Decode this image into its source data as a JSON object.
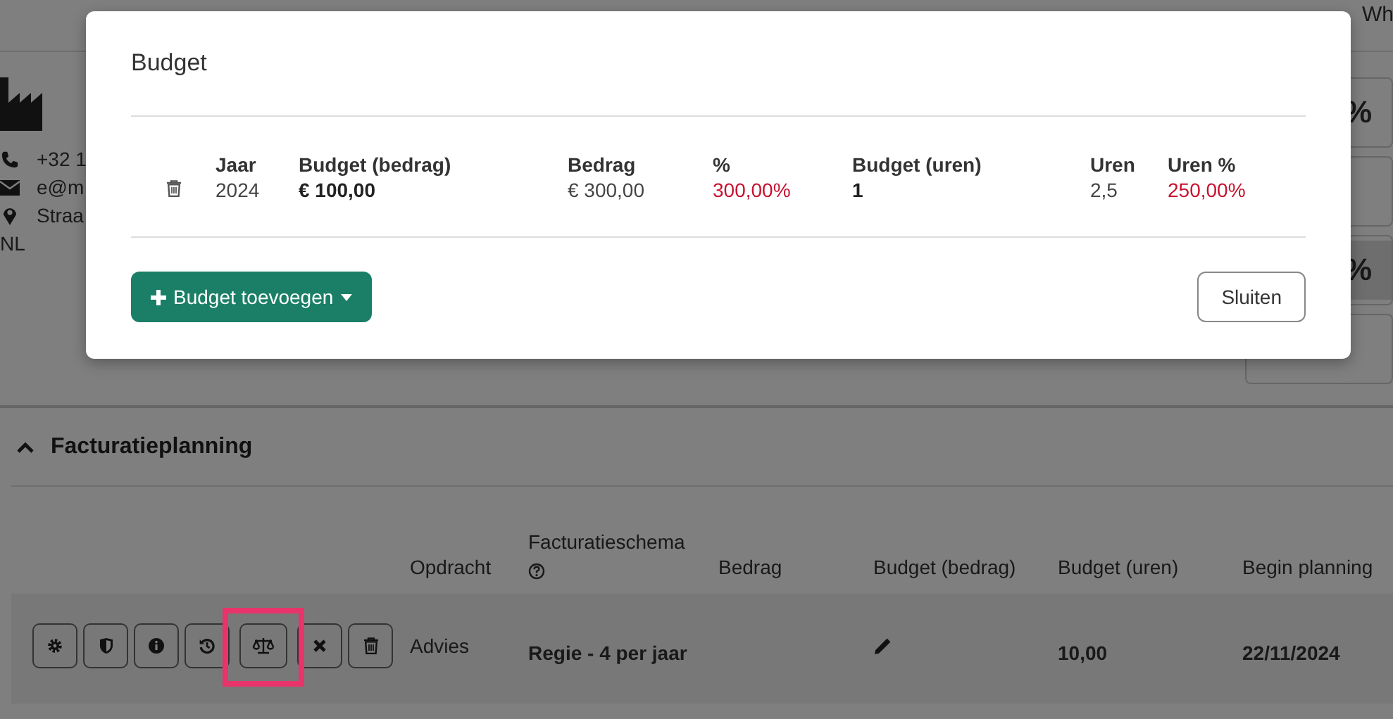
{
  "top_nav": {
    "tabs": [
      {
        "label": "Wh",
        "selected": false
      }
    ]
  },
  "relation": {
    "phone": "+32 1",
    "email": "e@m",
    "address": "Straa",
    "country": "NL"
  },
  "side_cards": [
    {
      "kind": "plain",
      "text": "%"
    },
    {
      "kind": "empty"
    },
    {
      "kind": "shaded",
      "text": "%"
    },
    {
      "kind": "empty"
    }
  ],
  "section": {
    "title": "Facturatieplanning",
    "expanded": true
  },
  "planning_table": {
    "columns": [
      {
        "label": "Opdracht",
        "help": false
      },
      {
        "label": "Facturatieschema",
        "help": true
      },
      {
        "label": "Bedrag",
        "help": false
      },
      {
        "label": "Budget (bedrag)",
        "help": false
      },
      {
        "label": "Budget (uren)",
        "help": false
      },
      {
        "label": "Begin planning",
        "help": false
      }
    ],
    "rows": [
      {
        "actions": [
          {
            "kind": "settings",
            "highlighted": false
          },
          {
            "kind": "shield",
            "highlighted": false
          },
          {
            "kind": "info",
            "highlighted": false
          },
          {
            "kind": "history",
            "highlighted": false
          },
          {
            "kind": "scale",
            "highlighted": true
          },
          {
            "kind": "close",
            "highlighted": false
          },
          {
            "kind": "trash",
            "highlighted": false
          }
        ],
        "cells": [
          {
            "kind": "plain",
            "text": "Advies"
          },
          {
            "kind": "bold",
            "text": "Regie - 4 per jaar"
          },
          {
            "kind": "empty"
          },
          {
            "kind": "edit"
          },
          {
            "kind": "bold",
            "text": "10,00"
          },
          {
            "kind": "bold",
            "text": "22/11/2024"
          }
        ]
      }
    ]
  },
  "modal": {
    "title": "Budget",
    "columns": [
      "Jaar",
      "Budget (bedrag)",
      "Bedrag",
      "%",
      "Budget (uren)",
      "Uren",
      "Uren %"
    ],
    "rows": [
      {
        "cells": [
          {
            "kind": "plain",
            "text": "2024"
          },
          {
            "kind": "bold",
            "text": "€ 100,00"
          },
          {
            "kind": "plain",
            "text": "€ 300,00"
          },
          {
            "kind": "warning",
            "text": "300,00%"
          },
          {
            "kind": "bold",
            "text": "1"
          },
          {
            "kind": "plain",
            "text": "2,5"
          },
          {
            "kind": "warning",
            "text": "250,00%"
          }
        ]
      }
    ],
    "add_button": "Budget toevoegen",
    "close_button": "Sluiten"
  }
}
